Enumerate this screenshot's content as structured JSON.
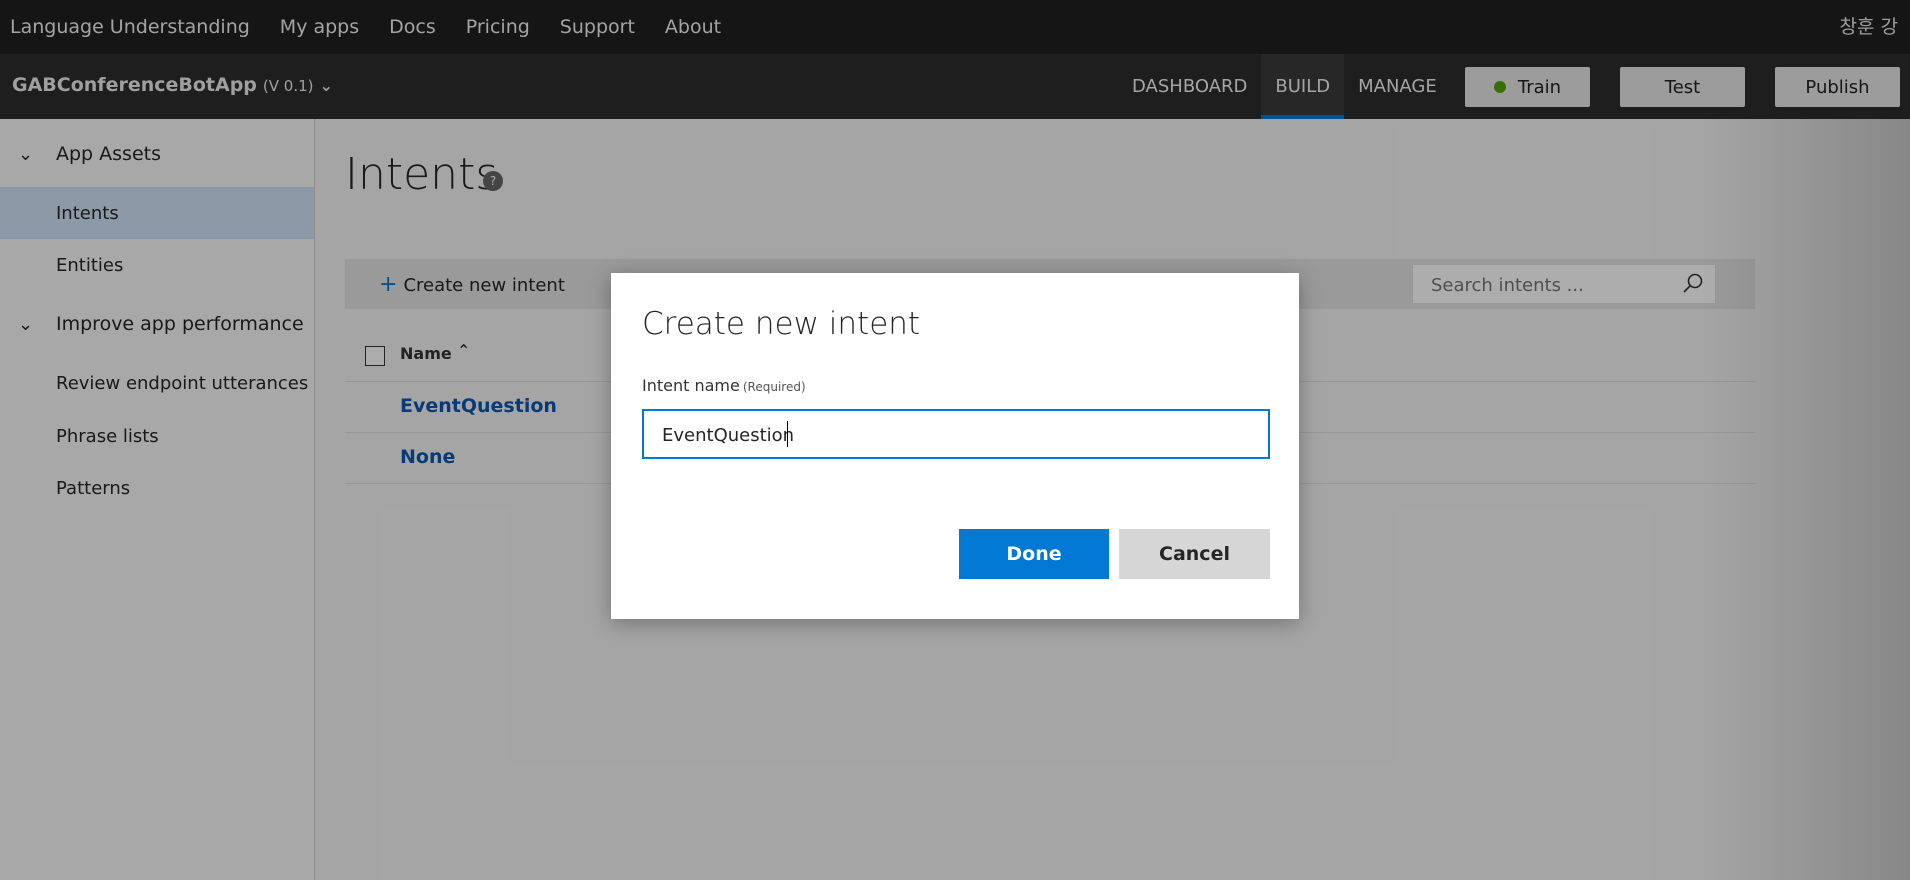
{
  "top_nav": {
    "items": [
      "Language Understanding",
      "My apps",
      "Docs",
      "Pricing",
      "Support",
      "About"
    ],
    "user_name": "창훈 강"
  },
  "app_bar": {
    "app_name": "GABConferenceBotApp",
    "version": "(V 0.1)",
    "tabs": [
      {
        "label": "DASHBOARD",
        "active": false
      },
      {
        "label": "BUILD",
        "active": true
      },
      {
        "label": "MANAGE",
        "active": false
      }
    ],
    "train_label": "Train",
    "train_status_color": "#57a300",
    "test_label": "Test",
    "publish_label": "Publish"
  },
  "sidebar": {
    "groups": [
      {
        "label": "App Assets",
        "items": [
          "Intents",
          "Entities"
        ]
      },
      {
        "label": "Improve app performance",
        "items": [
          "Review endpoint utterances",
          "Phrase lists",
          "Patterns"
        ]
      }
    ],
    "active_item": "Intents"
  },
  "main": {
    "title": "Intents",
    "help_label": "?",
    "create_label": "Create new intent",
    "search_placeholder": "Search intents ...",
    "column_name": "Name",
    "rows": [
      "EventQuestion",
      "None"
    ]
  },
  "modal": {
    "title": "Create new intent",
    "field_label": "Intent name",
    "field_required": "(Required)",
    "field_value": "EventQuestion",
    "done_label": "Done",
    "cancel_label": "Cancel"
  },
  "colors": {
    "accent": "#0078d4",
    "link": "#0a58b0"
  }
}
